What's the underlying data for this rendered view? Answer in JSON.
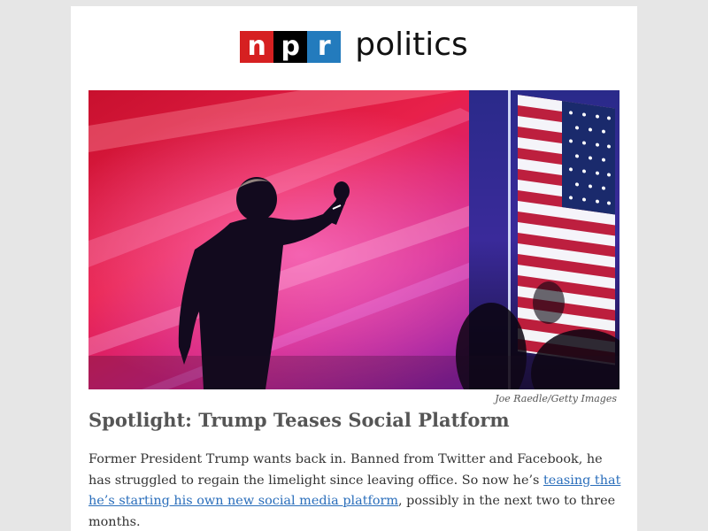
{
  "brand": {
    "logo_letters": [
      "n",
      "p",
      "r"
    ],
    "section_name": "politics",
    "colors": {
      "n": "#d62021",
      "p": "#000000",
      "r": "#237bbd"
    }
  },
  "hero_image": {
    "alt": "Trump raising fist on stage with American flag",
    "credit": "Joe Raedle/Getty Images"
  },
  "article": {
    "headline": "Spotlight: Trump Teases Social Platform",
    "body_before_link": "Former President Trump wants back in. Banned from Twitter and Facebook, he has struggled to regain the limelight since leaving office. So now he’s ",
    "link_text": "teasing that he’s starting his own new social media platform",
    "body_after_link": ", possibly in the next two to three months.",
    "link_color": "#2a6ebb"
  }
}
